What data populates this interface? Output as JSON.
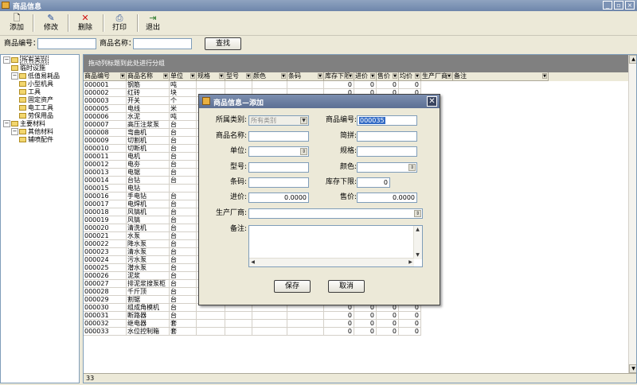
{
  "window": {
    "title": "商品信息"
  },
  "toolbar": {
    "add": "添加",
    "edit": "修改",
    "delete": "删除",
    "print": "打印",
    "exit": "退出"
  },
  "search": {
    "code_label": "商品编号：",
    "code_value": "",
    "name_label": "商品名称：",
    "name_value": "",
    "button": "查找"
  },
  "tree": [
    {
      "label": "所有类别",
      "level": 0,
      "expanded": true,
      "selected": true
    },
    {
      "label": "临时设施",
      "level": 1
    },
    {
      "label": "低值易耗品",
      "level": 1,
      "expanded": true
    },
    {
      "label": "小型机具",
      "level": 2
    },
    {
      "label": "工具",
      "level": 2
    },
    {
      "label": "固定资产",
      "level": 2
    },
    {
      "label": "电工工具",
      "level": 2
    },
    {
      "label": "劳保用品",
      "level": 2
    },
    {
      "label": "主要材料",
      "level": 0,
      "expanded": true
    },
    {
      "label": "其他材料",
      "level": 1,
      "expanded": true
    },
    {
      "label": "辅喷配件",
      "level": 2
    }
  ],
  "grid": {
    "group_hint": "拖动列标题到此处进行分组",
    "columns": [
      "商品编号",
      "商品名称",
      "单位",
      "规格",
      "型号",
      "颜色",
      "条码",
      "库存下限",
      "进价",
      "售价",
      "均价",
      "生产厂商",
      "备注"
    ],
    "rows": [
      [
        "000001",
        "钢筋",
        "吨",
        "0",
        "0",
        "0"
      ],
      [
        "000002",
        "红砖",
        "块",
        "0",
        "0",
        "0"
      ],
      [
        "000003",
        "开关",
        "个",
        "0",
        "0",
        "0"
      ],
      [
        "000005",
        "电线",
        "米",
        "0",
        "0",
        "0"
      ],
      [
        "000006",
        "水泥",
        "吨",
        "0",
        "0",
        "0"
      ],
      [
        "000007",
        "高压注浆泵",
        "台",
        "0",
        "0",
        "0"
      ],
      [
        "000008",
        "弯曲机",
        "台",
        "0",
        "0",
        "0"
      ],
      [
        "000009",
        "切割机",
        "台",
        "0",
        "0",
        "0"
      ],
      [
        "000010",
        "切断机",
        "台",
        "0",
        "0",
        "0"
      ],
      [
        "000011",
        "电机",
        "台",
        "0",
        "0",
        "0"
      ],
      [
        "000012",
        "电夯",
        "台",
        "0",
        "0",
        "0"
      ],
      [
        "000013",
        "电锯",
        "台",
        "0",
        "0",
        "0"
      ],
      [
        "000014",
        "台钻",
        "台",
        "0",
        "0",
        "0"
      ],
      [
        "000015",
        "电钻",
        "",
        "0",
        "0",
        "0"
      ],
      [
        "000016",
        "手电钻",
        "台",
        "0",
        "0",
        "0"
      ],
      [
        "000017",
        "电焊机",
        "台",
        "0",
        "0",
        "0"
      ],
      [
        "000018",
        "风镐机",
        "台",
        "0",
        "0",
        "0"
      ],
      [
        "000019",
        "风镐",
        "台",
        "0",
        "0",
        "0"
      ],
      [
        "000020",
        "清洗机",
        "台",
        "0",
        "0",
        "0"
      ],
      [
        "000021",
        "水泵",
        "台",
        "0",
        "0",
        "0"
      ],
      [
        "000022",
        "降水泵",
        "台",
        "0",
        "0",
        "0"
      ],
      [
        "000023",
        "清水泵",
        "台",
        "0",
        "0",
        "0"
      ],
      [
        "000024",
        "污水泵",
        "台",
        "0",
        "0",
        "0"
      ],
      [
        "000025",
        "潜水泵",
        "台",
        "0",
        "0",
        "0"
      ],
      [
        "000026",
        "泥浆",
        "台",
        "0",
        "0",
        "0"
      ],
      [
        "000027",
        "排泥浆搜泵柜",
        "台",
        "0",
        "0",
        "0"
      ],
      [
        "000028",
        "千斤顶",
        "台",
        "0",
        "0",
        "0"
      ],
      [
        "000029",
        "割锯",
        "台",
        "0",
        "0",
        "0"
      ],
      [
        "000030",
        "组成角模机",
        "台",
        "0",
        "0",
        "0"
      ],
      [
        "000031",
        "断路器",
        "台",
        "0",
        "0",
        "0"
      ],
      [
        "000032",
        "继电器",
        "套",
        "0",
        "0",
        "0"
      ],
      [
        "000033",
        "水位控制箱",
        "套",
        "0",
        "0",
        "0"
      ]
    ],
    "footer_count": "33"
  },
  "dialog": {
    "title": "商品信息—添加",
    "category_label": "所属类别:",
    "category_value": "所有类别",
    "code_label": "商品编号:",
    "code_value": "000035",
    "name_label": "商品名称:",
    "name_value": "",
    "pinyin_label": "简拼:",
    "pinyin_value": "",
    "unit_label": "单位:",
    "unit_value": "",
    "spec_label": "规格:",
    "spec_value": "",
    "model_label": "型号:",
    "model_value": "",
    "color_label": "颜色:",
    "color_value": "",
    "barcode_label": "条码:",
    "barcode_value": "",
    "min_stock_label": "库存下限:",
    "min_stock_value": "0",
    "buy_price_label": "进价:",
    "buy_price_value": "0.0000",
    "sell_price_label": "售价:",
    "sell_price_value": "0.0000",
    "maker_label": "生产厂商:",
    "maker_value": "",
    "note_label": "备注:",
    "note_value": "",
    "save": "保存",
    "cancel": "取消"
  }
}
